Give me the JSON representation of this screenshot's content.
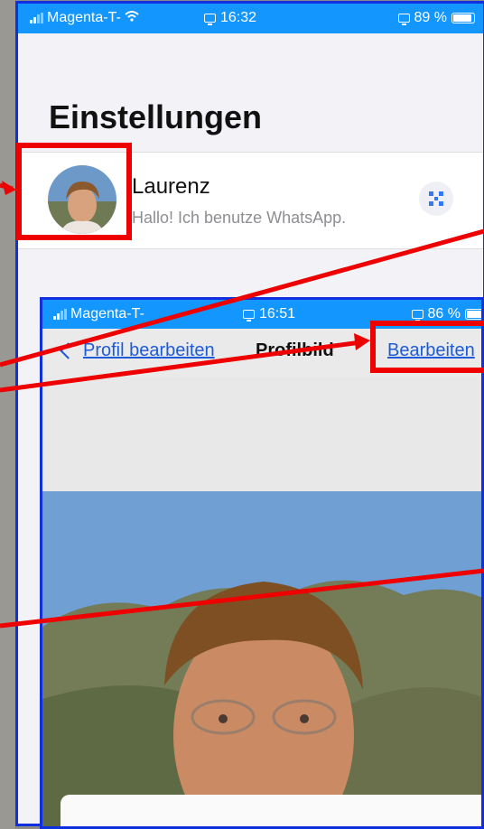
{
  "outer": {
    "status": {
      "carrier": "Magenta-T-",
      "time": "16:32",
      "battery": "89 %"
    },
    "title": "Einstellungen",
    "profile": {
      "name": "Laurenz",
      "status": "Hallo! Ich benutze WhatsApp."
    }
  },
  "inner": {
    "status": {
      "carrier": "Magenta-T-",
      "time": "16:51",
      "battery": "86 %"
    },
    "nav": {
      "back": "Profil bearbeiten",
      "title": "Profilbild",
      "edit": "Bearbeiten"
    }
  },
  "icons": [
    "signal-icon",
    "wifi-icon",
    "screen-mirror-icon",
    "battery-icon",
    "qr-code-icon",
    "chevron-left-icon"
  ],
  "colors": {
    "highlight": "#ee0000",
    "frame": "#1030e0",
    "status_bar": "#1496ff",
    "link": "#1d5bd8"
  }
}
